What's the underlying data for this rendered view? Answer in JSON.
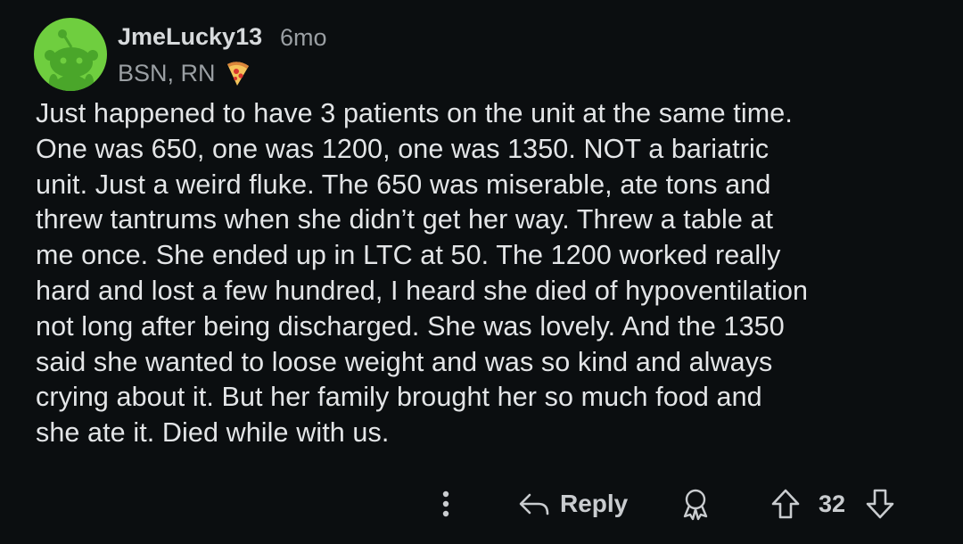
{
  "comment": {
    "username": "JmeLucky13",
    "age": "6mo",
    "flair": "BSN, RN",
    "flair_icon": "pizza-slice",
    "body": "Just happened to have 3 patients on the unit at the same time.\nOne was 650, one was 1200, one was 1350. NOT a bariatric\nunit. Just a weird fluke. The 650 was miserable, ate tons and\nthrew tantrums when she didn’t get her way. Threw a table at\nme once. She ended up in LTC at 50. The 1200 worked really\nhard and lost a few hundred, I heard she died of hypoventilation\nnot long after being discharged. She was lovely. And the 1350\nsaid she wanted to loose weight and was so kind and always\ncrying about it. But her family brought her so much food and\nshe ate it. Died while with us."
  },
  "actions": {
    "reply_label": "Reply",
    "score": "32"
  },
  "colors": {
    "background": "#0b0e10",
    "avatar_bg": "#6fce3f",
    "text": "#e3e5e7",
    "muted": "#9a9fa3"
  }
}
